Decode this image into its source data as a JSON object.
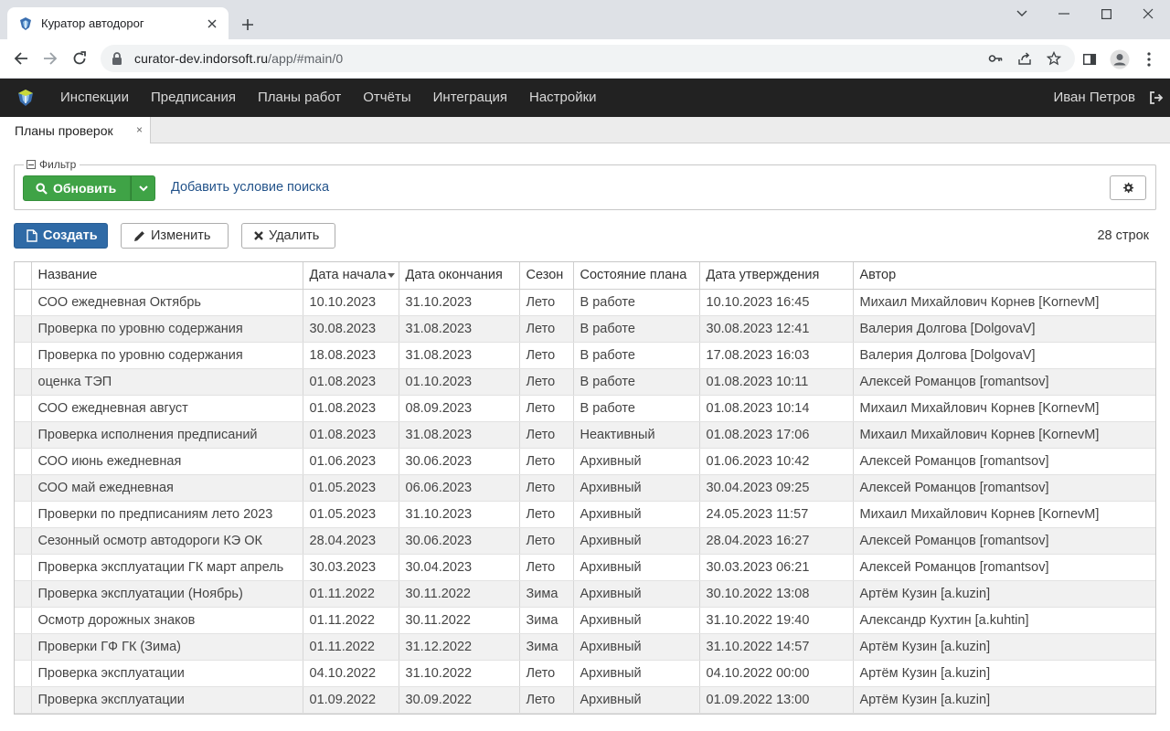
{
  "browser": {
    "tab_title": "Куратор автодорог",
    "url_host": "curator-dev.indorsoft.ru",
    "url_path": "/app/#main/0"
  },
  "nav": {
    "items": [
      "Инспекции",
      "Предписания",
      "Планы работ",
      "Отчёты",
      "Интеграция",
      "Настройки"
    ],
    "user": "Иван Петров"
  },
  "app_tabs": [
    {
      "label": "Планы проверок",
      "close": "×"
    }
  ],
  "filter": {
    "legend": "Фильтр",
    "refresh_label": "Обновить",
    "add_condition": "Добавить условие поиска"
  },
  "toolbar": {
    "create": "Создать",
    "edit": "Изменить",
    "delete": "Удалить",
    "row_count": "28 строк"
  },
  "table": {
    "columns": [
      "Название",
      "Дата начала",
      "Дата окончания",
      "Сезон",
      "Состояние плана",
      "Дата утверждения",
      "Автор"
    ],
    "rows": [
      [
        "СОО ежедневная Октябрь",
        "10.10.2023",
        "31.10.2023",
        "Лето",
        "В работе",
        "10.10.2023 16:45",
        "Михаил Михайлович Корнев [KornevM]"
      ],
      [
        "Проверка по уровню содержания",
        "30.08.2023",
        "31.08.2023",
        "Лето",
        "В работе",
        "30.08.2023 12:41",
        "Валерия Долгова [DolgovaV]"
      ],
      [
        "Проверка по уровню содержания",
        "18.08.2023",
        "31.08.2023",
        "Лето",
        "В работе",
        "17.08.2023 16:03",
        "Валерия Долгова [DolgovaV]"
      ],
      [
        "оценка ТЭП",
        "01.08.2023",
        "01.10.2023",
        "Лето",
        "В работе",
        "01.08.2023 10:11",
        "Алексей Романцов [romantsov]"
      ],
      [
        "СОО ежедневная август",
        "01.08.2023",
        "08.09.2023",
        "Лето",
        "В работе",
        "01.08.2023 10:14",
        "Михаил Михайлович Корнев [KornevM]"
      ],
      [
        "Проверка исполнения предписаний",
        "01.08.2023",
        "31.08.2023",
        "Лето",
        "Неактивный",
        "01.08.2023 17:06",
        "Михаил Михайлович Корнев [KornevM]"
      ],
      [
        "СОО июнь ежедневная",
        "01.06.2023",
        "30.06.2023",
        "Лето",
        "Архивный",
        "01.06.2023 10:42",
        "Алексей Романцов [romantsov]"
      ],
      [
        "СОО май ежедневная",
        "01.05.2023",
        "06.06.2023",
        "Лето",
        "Архивный",
        "30.04.2023 09:25",
        "Алексей Романцов [romantsov]"
      ],
      [
        "Проверки по предписаниям лето 2023",
        "01.05.2023",
        "31.10.2023",
        "Лето",
        "Архивный",
        "24.05.2023 11:57",
        "Михаил Михайлович Корнев [KornevM]"
      ],
      [
        "Сезонный осмотр автодороги КЭ ОК",
        "28.04.2023",
        "30.06.2023",
        "Лето",
        "Архивный",
        "28.04.2023 16:27",
        "Алексей Романцов [romantsov]"
      ],
      [
        "Проверка эксплуатации ГК март апрель",
        "30.03.2023",
        "30.04.2023",
        "Лето",
        "Архивный",
        "30.03.2023 06:21",
        "Алексей Романцов [romantsov]"
      ],
      [
        "Проверка эксплуатации (Ноябрь)",
        "01.11.2022",
        "30.11.2022",
        "Зима",
        "Архивный",
        "30.10.2022 13:08",
        "Артём Кузин [a.kuzin]"
      ],
      [
        "Осмотр дорожных знаков",
        "01.11.2022",
        "30.11.2022",
        "Зима",
        "Архивный",
        "31.10.2022 19:40",
        "Александр Кухтин [a.kuhtin]"
      ],
      [
        "Проверки ГФ ГК (Зима)",
        "01.11.2022",
        "31.12.2022",
        "Зима",
        "Архивный",
        "31.10.2022 14:57",
        "Артём Кузин [a.kuzin]"
      ],
      [
        "Проверка эксплуатации",
        "04.10.2022",
        "31.10.2022",
        "Лето",
        "Архивный",
        "04.10.2022 00:00",
        "Артём Кузин [a.kuzin]"
      ],
      [
        "Проверка эксплуатации",
        "01.09.2022",
        "30.09.2022",
        "Лето",
        "Архивный",
        "01.09.2022 13:00",
        "Артём Кузин [a.kuzin]"
      ]
    ]
  },
  "colors": {
    "navbar": "#222222",
    "refresh_green": "#3fa346",
    "create_blue": "#2f6aa6",
    "link_blue": "#23538a"
  }
}
